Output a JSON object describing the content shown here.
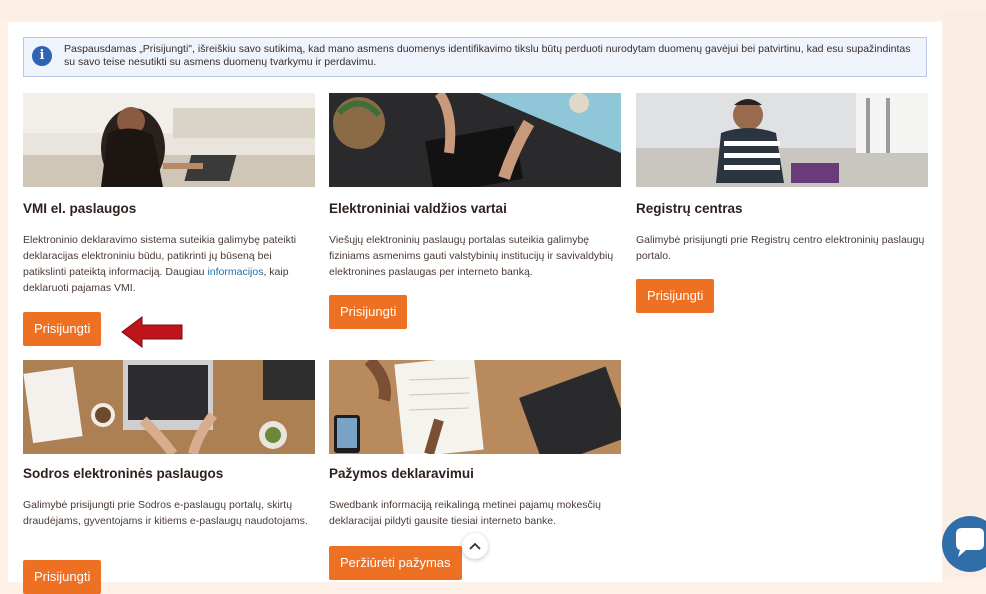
{
  "notice": {
    "icon": "info-icon",
    "text": "Paspausdamas „Prisijungti\", išreiškiu savo sutikimą, kad mano asmens duomenys identifikavimo tikslu būtų perduoti nurodytam duomenų gavėjui bei patvirtinu, kad esu supažindintas su savo teise nesutikti su asmens duomenų tvarkymu ir perdavimu."
  },
  "cards": [
    {
      "title": "VMI el. paslaugos",
      "text_before": "Elektroninio deklaravimo sistema suteikia galimybę pateikti deklaracijas elektroniniu būdu, patikrinti jų būseną bei patikslinti pateiktą informaciją. Daugiau ",
      "link": "informacijos",
      "text_after": ", kaip deklaruoti pajamas VMI.",
      "button": "Prisijungti"
    },
    {
      "title": "Elektroniniai valdžios vartai",
      "text": "Viešųjų elektroninių paslaugų portalas suteikia galimybę fiziniams asmenims gauti valstybinių institucijų ir savivaldybių elektronines paslaugas per interneto banką.",
      "button": "Prisijungti"
    },
    {
      "title": "Registrų centras",
      "text": "Galimybė prisijungti prie Registrų centro elektroninių paslaugų portalo.",
      "button": "Prisijungti"
    },
    {
      "title": "Sodros elektroninės paslaugos",
      "text": "Galimybė prisijungti prie Sodros e-paslaugų portalų, skirtų draudėjams, gyventojams ir kitiems e-paslaugų naudotojams.",
      "button": "Prisijungti"
    },
    {
      "title": "Pažymos deklaravimui",
      "text": "Swedbank informaciją reikalingą metinei pajamų mokesčių deklaracijai pildyti gausite tiesiai interneto banke.",
      "button": "Peržiūrėti pažymas"
    }
  ],
  "colors": {
    "accent": "#ee7023",
    "arrow": "#c0141b",
    "link": "#1e6fa8"
  },
  "scroll_up_icon": "chevron-up-icon",
  "chat_icon": "chat-icon"
}
